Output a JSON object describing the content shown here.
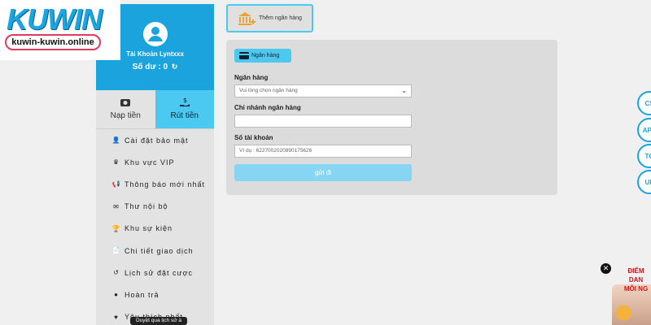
{
  "logo": {
    "brand": "KUWIN",
    "url": "kuwin-kuwin.online"
  },
  "account": {
    "name": "Tài Khoản Lyntxxx",
    "balance_label": "Số dư :",
    "balance_value": "0",
    "refresh_icon": "↻"
  },
  "tabs": [
    {
      "label": "Nạp tiền",
      "icon": "wallet-icon"
    },
    {
      "label": "Rút tiền",
      "icon": "hand-money-icon",
      "active": true
    }
  ],
  "menu": [
    {
      "label": "Cài đặt bảo mật",
      "icon": "user-lock-icon"
    },
    {
      "label": "Khu vực VIP",
      "icon": "crown-icon"
    },
    {
      "label": "Thông báo mới nhất",
      "icon": "megaphone-icon"
    },
    {
      "label": "Thư nội bộ",
      "icon": "mail-icon"
    },
    {
      "label": "Khu sự kiện",
      "icon": "trophy-icon"
    },
    {
      "label": "Chi tiết giao dịch",
      "icon": "document-icon"
    },
    {
      "label": "Lịch sử đặt cược",
      "icon": "history-icon"
    },
    {
      "label": "Hoàn trả",
      "icon": "coin-icon"
    },
    {
      "label": "Yêu thích nhất",
      "icon": "heart-icon"
    }
  ],
  "top_button": {
    "label": "Thêm ngân hàng"
  },
  "form": {
    "pill_label": "Ngân hàng",
    "bank_label": "Ngân hàng",
    "bank_placeholder": "Vui lòng chọn ngân hàng",
    "branch_label": "Chi nhánh ngân hàng",
    "branch_value": "",
    "account_label": "Số tài khoản",
    "account_placeholder": "Ví dụ : 6227002020890175626",
    "submit_label": "gửi đi"
  },
  "floating": [
    {
      "label": "CS"
    },
    {
      "label": "APP"
    },
    {
      "label": "TG"
    },
    {
      "label": "UP"
    }
  ],
  "promo": {
    "line1": "ĐIỂM DAN",
    "line2": "MỖI NG"
  },
  "tooltip": "Duyệt qua lịch sử à",
  "colors": {
    "accent": "#1aa3dd",
    "active_tab": "#4cc9f0",
    "submit": "#86d6f3"
  }
}
